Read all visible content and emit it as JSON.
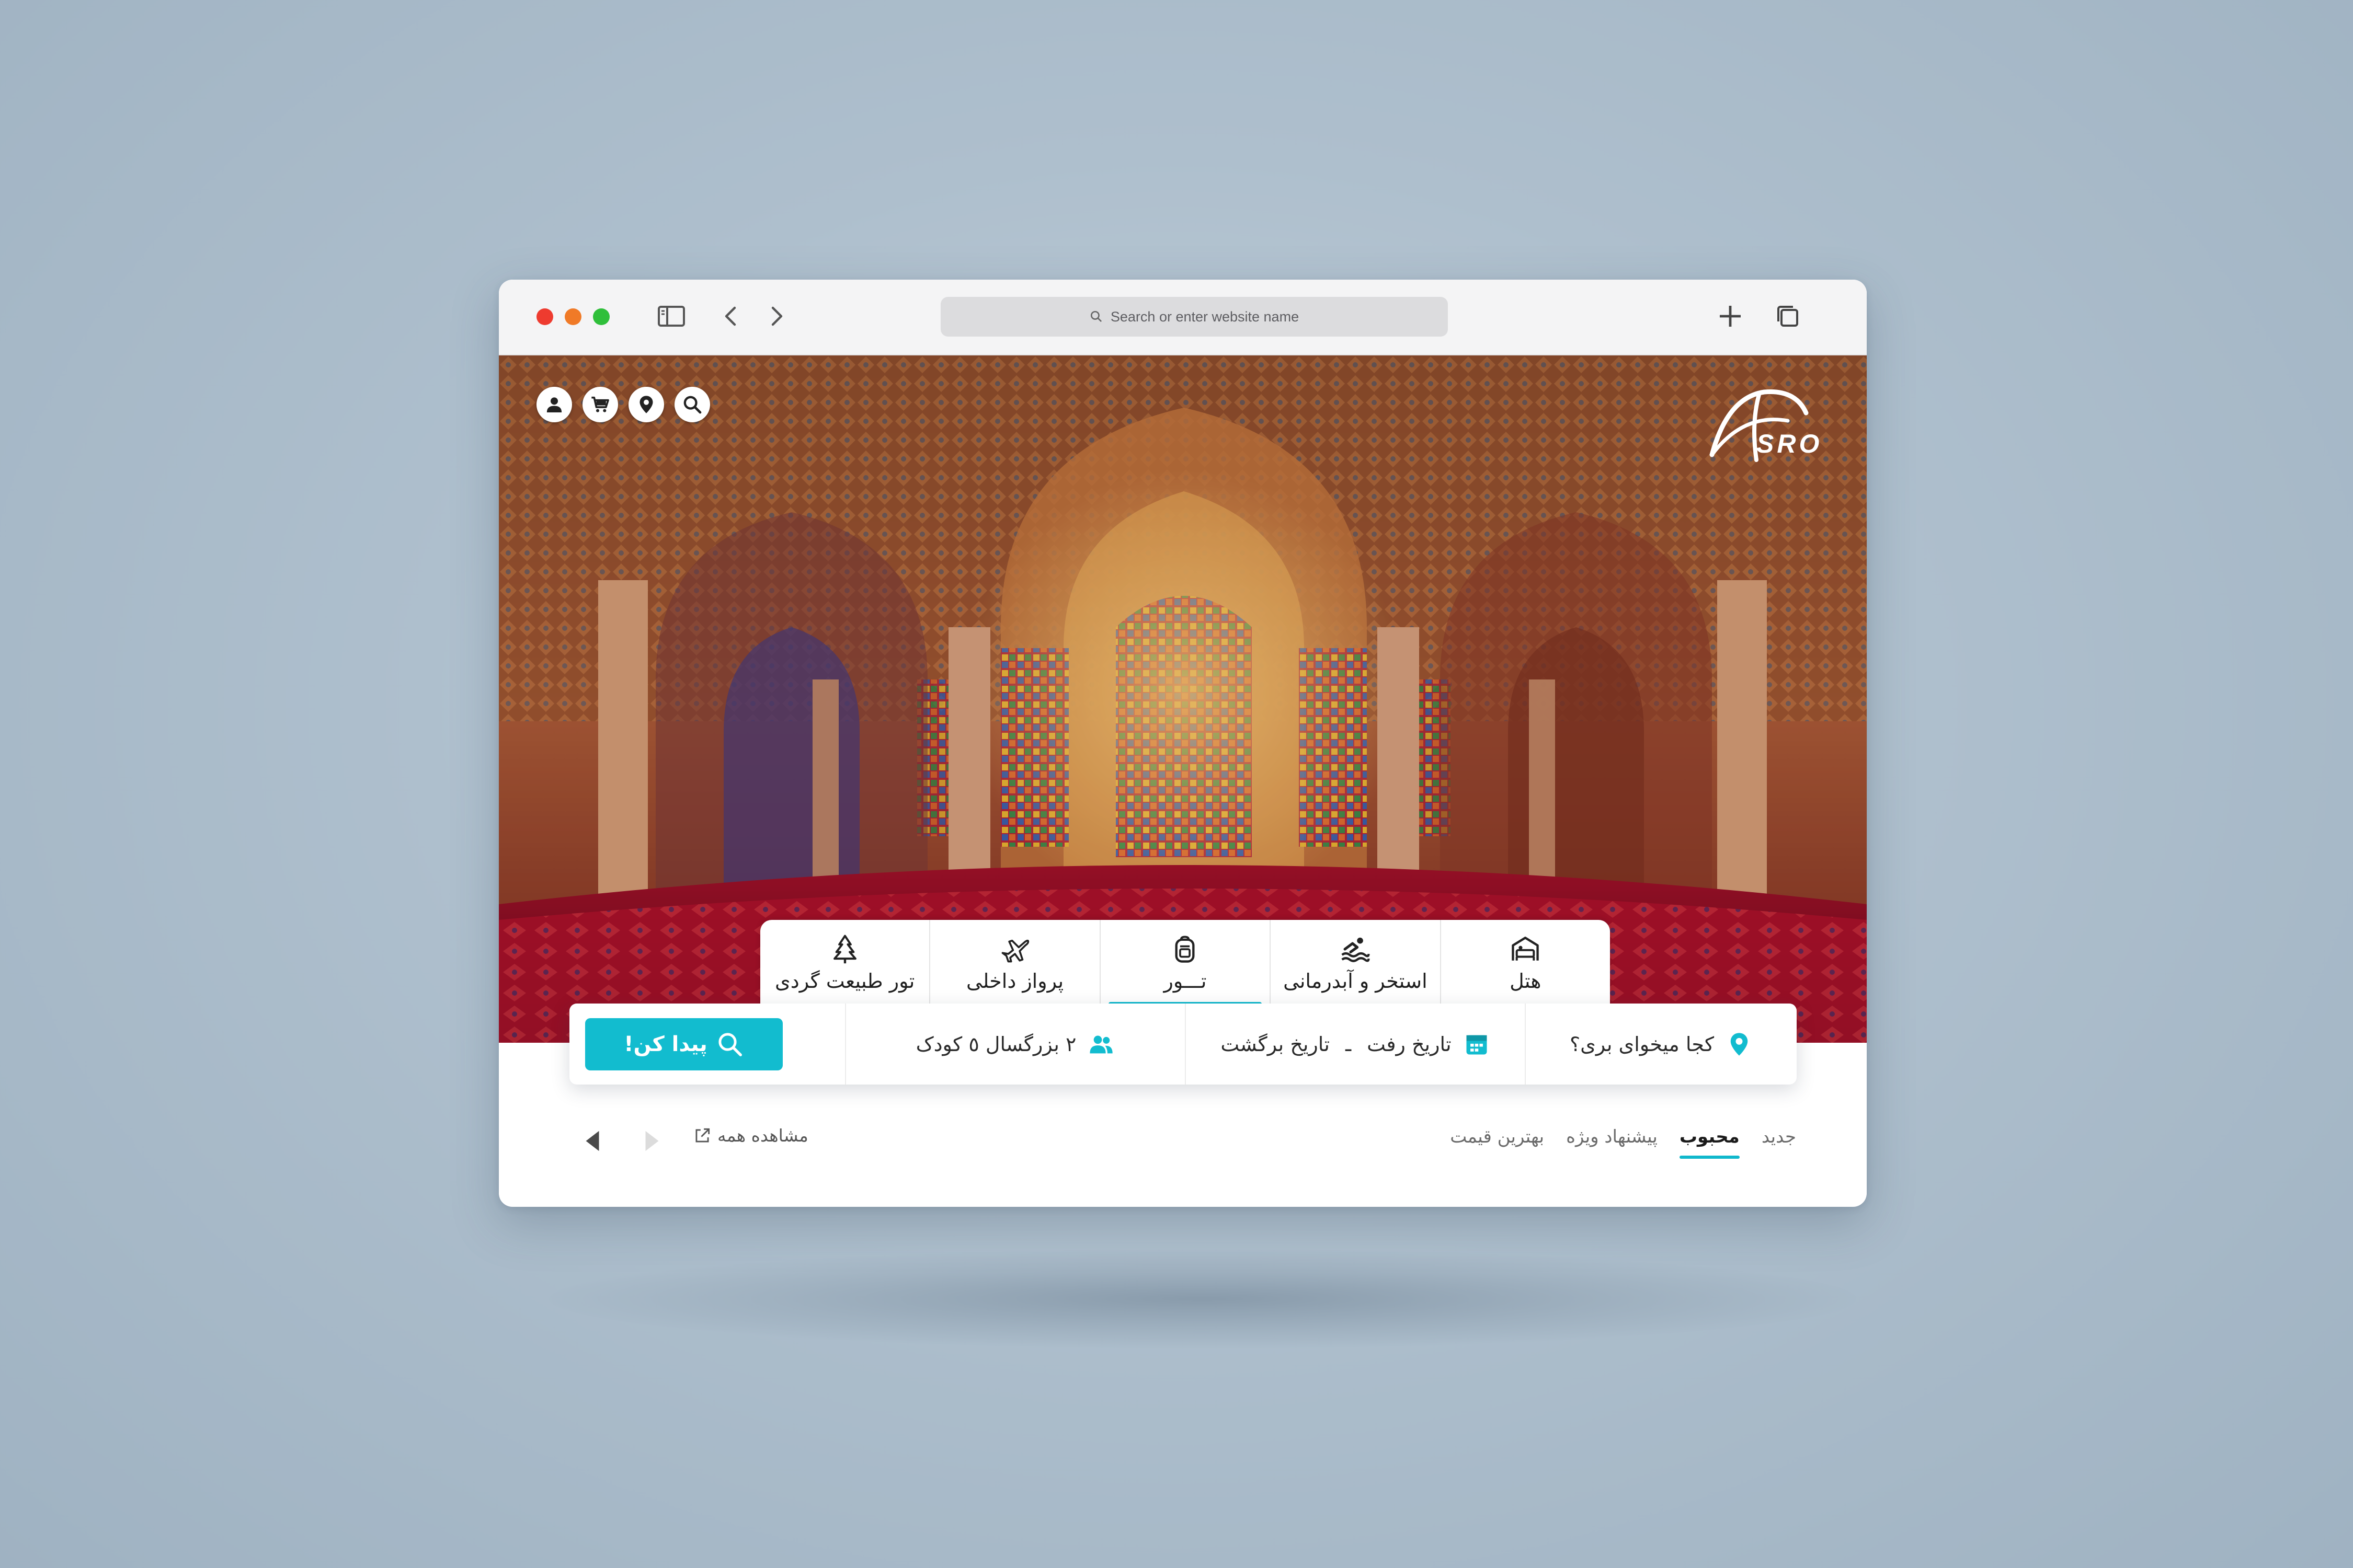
{
  "browser": {
    "address_placeholder": "Search or enter website name",
    "icons": [
      "sidebar-icon",
      "back-icon",
      "forward-icon",
      "new-tab-icon",
      "tabs-overview-icon"
    ]
  },
  "site": {
    "logo_text": "SRO",
    "utility_icons": [
      "user-icon",
      "cart-icon",
      "location-icon",
      "search-icon"
    ]
  },
  "categories": [
    {
      "label": "هتل",
      "icon": "hotel-icon",
      "active": false
    },
    {
      "label": "استخر و آبدرمانی",
      "icon": "swimming-icon",
      "active": false
    },
    {
      "label": "تـــور",
      "icon": "backpack-icon",
      "active": true
    },
    {
      "label": "پرواز داخلی",
      "icon": "airplane-icon",
      "active": false
    },
    {
      "label": "تور طبیعت گردی",
      "icon": "tree-icon",
      "active": false
    }
  ],
  "search": {
    "destination": "کجا میخوای بری؟",
    "depart": "تاریخ رفت",
    "return": "تاریخ برگشت",
    "dash": "ـ",
    "passengers": "۲ بزرگسال ٥ کودک",
    "button": "پیدا کن!"
  },
  "filters": {
    "items": [
      "جدید",
      "محبوب",
      "پیشنهاد ویژه",
      "بهترین قیمت"
    ],
    "active": "محبوب",
    "see_all": "مشاهده همه"
  },
  "colors": {
    "accent": "#12bccf",
    "traffic_red": "#ee3b2f",
    "traffic_yellow": "#f07a27",
    "traffic_green": "#2fbf3a"
  }
}
